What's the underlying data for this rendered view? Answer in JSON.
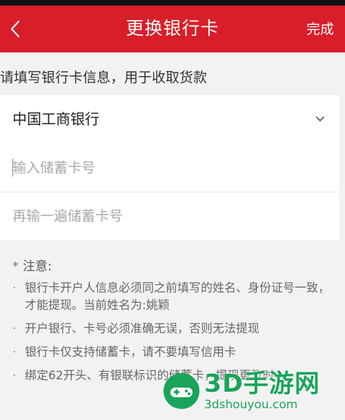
{
  "header": {
    "title": "更换银行卡",
    "done_label": "完成"
  },
  "hint": "请填写银行卡信息，用于收取货款",
  "form": {
    "bank_selected": "中国工商银行",
    "card_number_placeholder": "输入储蓄卡号",
    "card_number_confirm_placeholder": "再输一遍储蓄卡号"
  },
  "notes": {
    "title": "注意:",
    "items": [
      "银行卡开户人信息必须同之前填写的姓名、身份证号一致，才能提现。当前姓名为:姚颖",
      "开户银行、卡号必须准确无误，否则无法提现",
      "银行卡仅支持储蓄卡，请不要填写信用卡",
      "绑定62开头、有银联标识的储蓄卡，提现更及时"
    ]
  },
  "watermark": {
    "name": "3D手游网",
    "url": "3dshouyou.com"
  },
  "colors": {
    "header_bg": "#d81e29",
    "watermark_green": "#1aa45a"
  },
  "icons": {
    "back": "chevron-left-icon",
    "dropdown": "chevron-down-icon"
  }
}
